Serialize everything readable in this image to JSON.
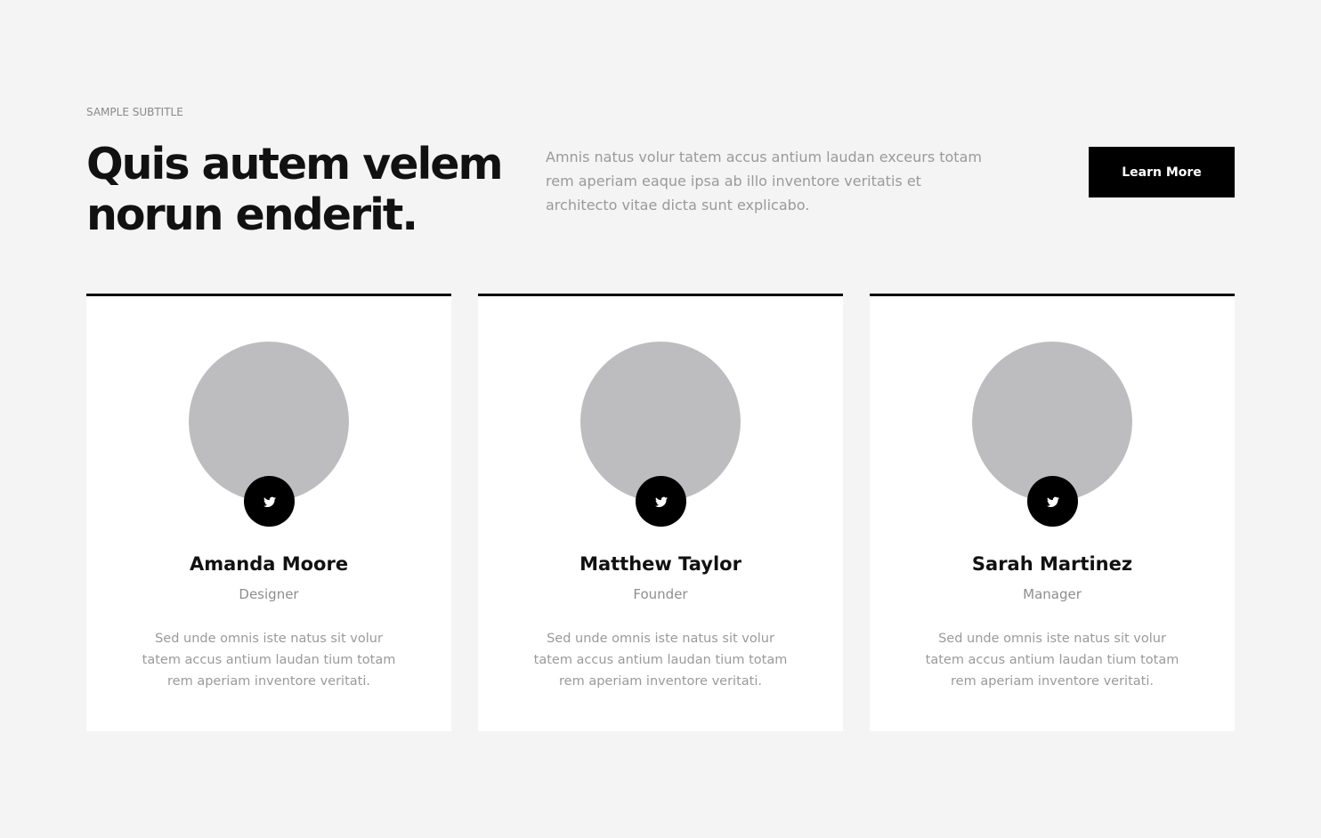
{
  "header": {
    "subtitle": "SAMPLE SUBTITLE",
    "title": "Quis autem velem norun enderit.",
    "intro": "Amnis natus volur tatem accus antium laudan exceurs totam rem aperiam eaque ipsa ab illo inventore veritatis et architecto vitae dicta sunt explicabo.",
    "cta_label": "Learn More"
  },
  "team": [
    {
      "name": "Amanda Moore",
      "role": "Designer",
      "bio": "Sed unde omnis iste natus sit volur tatem accus antium laudan tium totam rem aperiam inventore veritati.",
      "social_icon": "twitter-icon"
    },
    {
      "name": "Matthew Taylor",
      "role": "Founder",
      "bio": "Sed unde omnis iste natus sit volur tatem accus antium laudan tium totam rem aperiam inventore veritati.",
      "social_icon": "twitter-icon"
    },
    {
      "name": "Sarah Martinez",
      "role": "Manager",
      "bio": "Sed unde omnis iste natus sit volur tatem accus antium laudan tium totam rem aperiam inventore veritati.",
      "social_icon": "twitter-icon"
    }
  ],
  "colors": {
    "background": "#f4f4f4",
    "card": "#ffffff",
    "accent": "#000000",
    "avatar_placeholder": "#bdbdbf",
    "muted_text": "#9a9a9a"
  }
}
